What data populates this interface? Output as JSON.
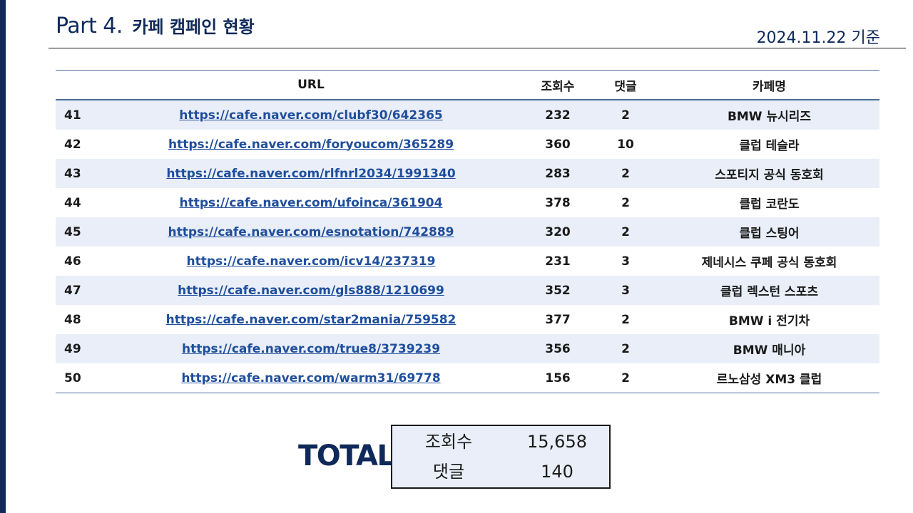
{
  "header": {
    "part": "Part 4.",
    "subtitle": "카페 캠페인 현황",
    "date": "2024.11.22 기준"
  },
  "table": {
    "columns": [
      "URL",
      "조회수",
      "댓글",
      "카페명"
    ],
    "rows": [
      {
        "no": "41",
        "url": "https://cafe.naver.com/clubf30/642365",
        "views": "232",
        "comments": "2",
        "cafe": "BMW 뉴시리즈"
      },
      {
        "no": "42",
        "url": "https://cafe.naver.com/foryoucom/365289",
        "views": "360",
        "comments": "10",
        "cafe": "클럽 테슬라"
      },
      {
        "no": "43",
        "url": "https://cafe.naver.com/rlfnrl2034/1991340",
        "views": "283",
        "comments": "2",
        "cafe": "스포티지 공식 동호회"
      },
      {
        "no": "44",
        "url": "https://cafe.naver.com/ufoinca/361904",
        "views": "378",
        "comments": "2",
        "cafe": "클럽 코란도"
      },
      {
        "no": "45",
        "url": "https://cafe.naver.com/esnotation/742889",
        "views": "320",
        "comments": "2",
        "cafe": "클럽 스팅어"
      },
      {
        "no": "46",
        "url": "https://cafe.naver.com/icv14/237319",
        "views": "231",
        "comments": "3",
        "cafe": "제네시스 쿠페 공식 동호회"
      },
      {
        "no": "47",
        "url": "https://cafe.naver.com/gls888/1210699",
        "views": "352",
        "comments": "3",
        "cafe": "클럽 렉스턴 스포츠"
      },
      {
        "no": "48",
        "url": "https://cafe.naver.com/star2mania/759582",
        "views": "377",
        "comments": "2",
        "cafe": "BMW i 전기차"
      },
      {
        "no": "49",
        "url": "https://cafe.naver.com/true8/3739239",
        "views": "356",
        "comments": "2",
        "cafe": "BMW 매니아"
      },
      {
        "no": "50",
        "url": "https://cafe.naver.com/warm31/69778",
        "views": "156",
        "comments": "2",
        "cafe": "르노삼성 XM3 클럽"
      }
    ]
  },
  "total": {
    "label": "TOTAL",
    "views_label": "조회수",
    "views_value": "15,658",
    "comments_label": "댓글",
    "comments_value": "140"
  },
  "colors": {
    "navy": "#0f2a5a",
    "link": "#1f4e9c",
    "row_stripe": "#e9eef8"
  }
}
